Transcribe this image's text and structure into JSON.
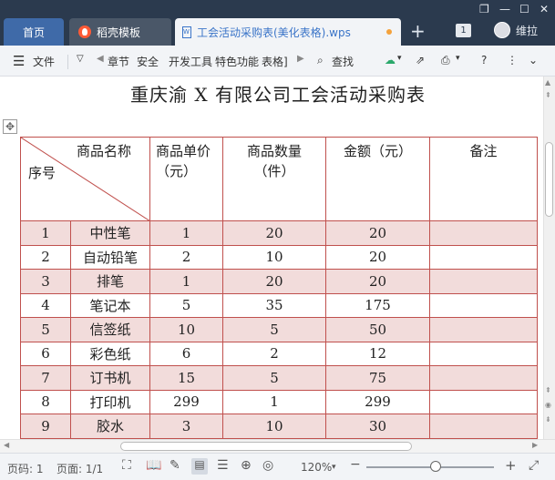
{
  "tabs": {
    "home": "首页",
    "template": "稻壳模板",
    "document": "工会活动采购表(美化表格).wps"
  },
  "window": {
    "page_count_badge": "1",
    "user_name": "维拉"
  },
  "menu": {
    "file": "文件",
    "items": [
      "章节",
      "安全",
      "开发工具",
      "特色功能",
      "表格]"
    ],
    "find": "查找"
  },
  "doc": {
    "title": "重庆渝 X 有限公司工会活动采购表",
    "headers": {
      "diag_top": "商品名称",
      "diag_bottom": "序号",
      "unit_price": "商品单价（元）",
      "quantity": "商品数量（件）",
      "amount": "金额（元）",
      "remark": "备注"
    },
    "rows": [
      {
        "no": "1",
        "name": "中性笔",
        "price": "1",
        "qty": "20",
        "amount": "20",
        "remark": ""
      },
      {
        "no": "2",
        "name": "自动铅笔",
        "price": "2",
        "qty": "10",
        "amount": "20",
        "remark": ""
      },
      {
        "no": "3",
        "name": "排笔",
        "price": "1",
        "qty": "20",
        "amount": "20",
        "remark": ""
      },
      {
        "no": "4",
        "name": "笔记本",
        "price": "5",
        "qty": "35",
        "amount": "175",
        "remark": ""
      },
      {
        "no": "5",
        "name": "信签纸",
        "price": "10",
        "qty": "5",
        "amount": "50",
        "remark": ""
      },
      {
        "no": "6",
        "name": "彩色纸",
        "price": "6",
        "qty": "2",
        "amount": "12",
        "remark": ""
      },
      {
        "no": "7",
        "name": "订书机",
        "price": "15",
        "qty": "5",
        "amount": "75",
        "remark": ""
      },
      {
        "no": "8",
        "name": "打印机",
        "price": "299",
        "qty": "1",
        "amount": "299",
        "remark": ""
      },
      {
        "no": "9",
        "name": "胶水",
        "price": "3",
        "qty": "10",
        "amount": "30",
        "remark": ""
      }
    ]
  },
  "status": {
    "page_no": "页码: 1",
    "pages": "页面: 1/1",
    "zoom": "120%"
  },
  "colors": {
    "tab_bar": "#2b3a4e",
    "border": "#c0504d",
    "band": "#f2dcdb",
    "accent": "#3a74c8"
  }
}
